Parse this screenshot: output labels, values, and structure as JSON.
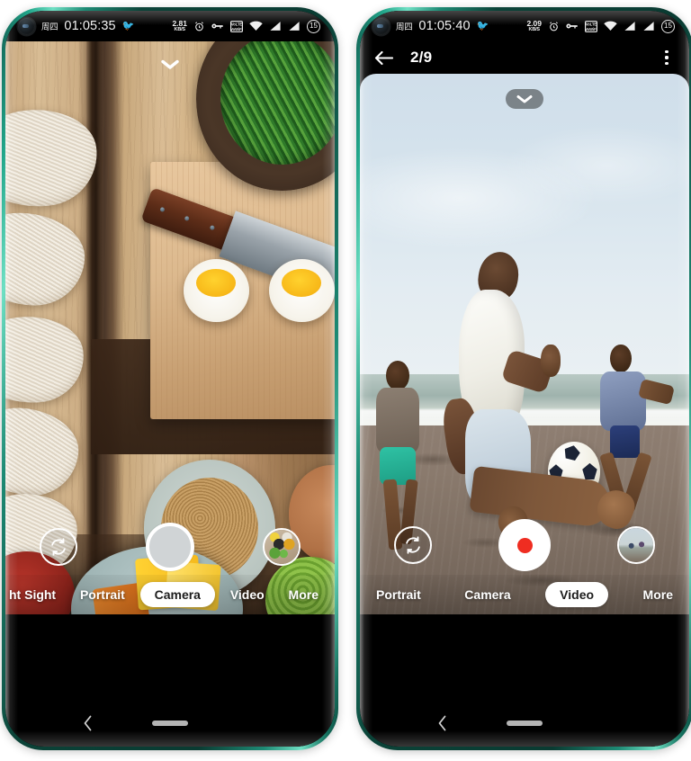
{
  "phones": [
    {
      "id": "left",
      "status_bar": {
        "day": "周四",
        "time": "01:05:35",
        "bird_icon": "bird-icon",
        "net_speed_value": "2.81",
        "net_speed_unit": "KB/S",
        "alarm_icon": "alarm-clock-icon",
        "key_icon": "vpn-key-icon",
        "vowifi_icon": "volte-vowifi-icon",
        "wifi_icon": "wifi-icon",
        "signal1_icon": "signal-bars-icon",
        "signal2_icon": "signal-bars-icon",
        "battery_percent": "15"
      },
      "header": null,
      "viewfinder": {
        "scene": "food-flatlay-noodles-eggs",
        "chevron_icon": "chevron-down-icon",
        "chevron_style": "plain"
      },
      "controls": {
        "flip_icon": "camera-flip-icon",
        "shutter_name": "photo-shutter-button",
        "shutter_type": "photo",
        "thumbnail_name": "last-photo-thumbnail"
      },
      "modes": [
        {
          "label": "ht Sight",
          "active": false,
          "clipped": true
        },
        {
          "label": "Portrait",
          "active": false,
          "clipped": false
        },
        {
          "label": "Camera",
          "active": true,
          "clipped": false
        },
        {
          "label": "Video",
          "active": false,
          "clipped": false
        },
        {
          "label": "More",
          "active": false,
          "clipped": false
        }
      ],
      "navbar": {
        "back_icon": "back-chevron-icon",
        "home_icon": "home-pill-icon"
      }
    },
    {
      "id": "right",
      "status_bar": {
        "day": "周四",
        "time": "01:05:40",
        "bird_icon": "bird-icon",
        "net_speed_value": "2.09",
        "net_speed_unit": "KB/S",
        "alarm_icon": "alarm-clock-icon",
        "key_icon": "vpn-key-icon",
        "vowifi_icon": "volte-vowifi-icon",
        "wifi_icon": "wifi-icon",
        "signal1_icon": "signal-bars-icon",
        "signal2_icon": "signal-bars-icon",
        "battery_percent": "15"
      },
      "header": {
        "back_icon": "arrow-left-icon",
        "title": "2/9",
        "menu_icon": "overflow-menu-icon"
      },
      "viewfinder": {
        "scene": "beach-football-players",
        "chevron_icon": "chevron-down-icon",
        "chevron_style": "pill"
      },
      "controls": {
        "flip_icon": "camera-flip-icon",
        "shutter_name": "video-record-button",
        "shutter_type": "video",
        "thumbnail_name": "last-photo-thumbnail"
      },
      "modes": [
        {
          "label": "Portrait",
          "active": false,
          "clipped": false
        },
        {
          "label": "Camera",
          "active": false,
          "clipped": false
        },
        {
          "label": "Video",
          "active": true,
          "clipped": false
        },
        {
          "label": "More",
          "active": false,
          "clipped": false
        }
      ],
      "navbar": {
        "back_icon": "back-chevron-icon",
        "home_icon": "home-pill-icon"
      }
    }
  ],
  "theme": {
    "frame_color": "#0f5b4e",
    "frame_highlight": "#6fe0c4",
    "record_dot": "#ef2d21",
    "active_pill_bg": "#ffffff",
    "active_pill_text": "#1d1d1d",
    "status_text": "#f2f2f2",
    "page_bg": "#ffffff"
  }
}
